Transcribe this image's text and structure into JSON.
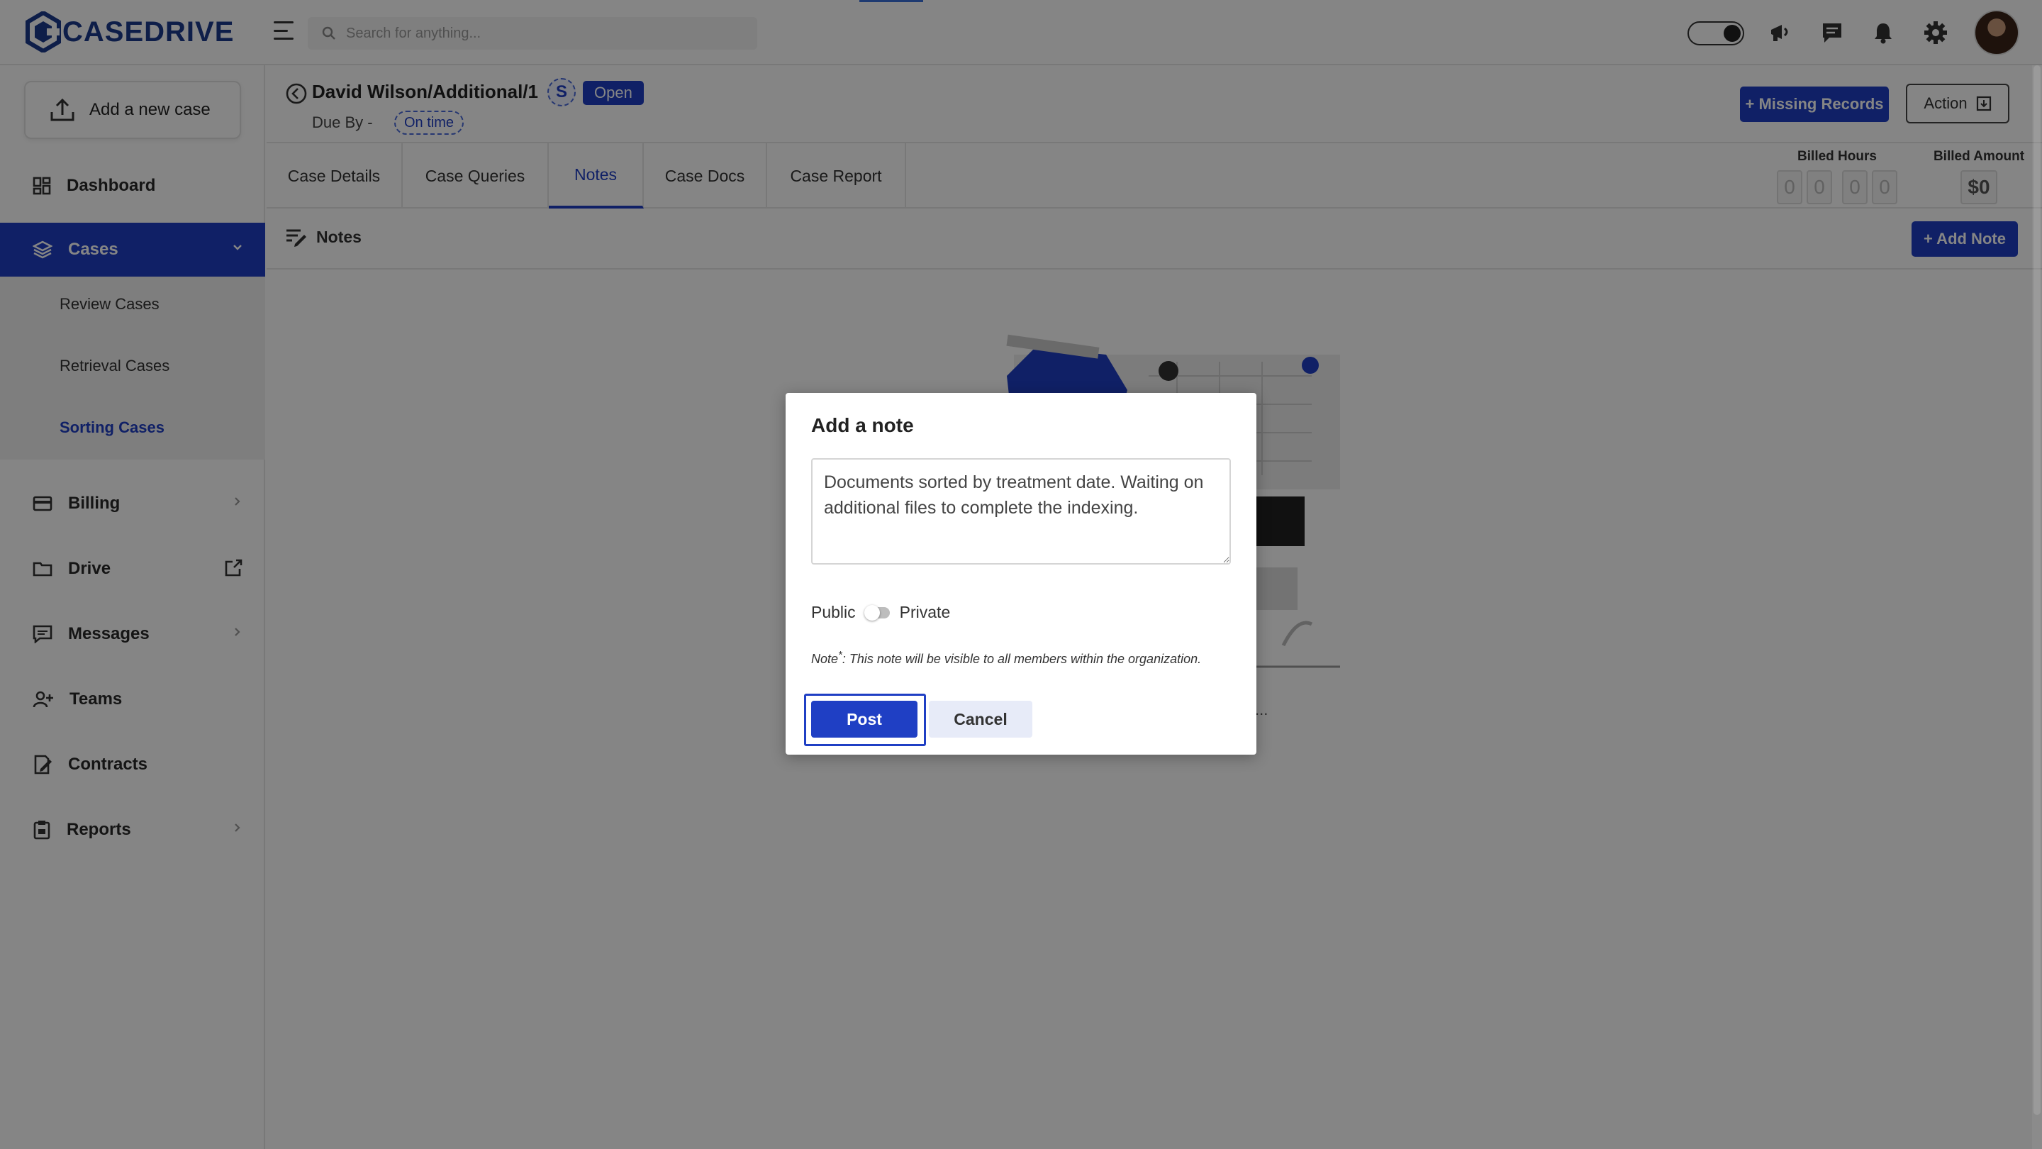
{
  "app": {
    "brand": "CASEDRIVE"
  },
  "search": {
    "placeholder": "Search for anything..."
  },
  "sidebar": {
    "add_case_label": "Add a new case",
    "items": [
      {
        "label": "Dashboard"
      },
      {
        "label": "Cases"
      },
      {
        "label": "Billing"
      },
      {
        "label": "Drive"
      },
      {
        "label": "Messages"
      },
      {
        "label": "Teams"
      },
      {
        "label": "Contracts"
      },
      {
        "label": "Reports"
      }
    ],
    "cases_sub": [
      {
        "label": "Review Cases"
      },
      {
        "label": "Retrieval Cases"
      },
      {
        "label": "Sorting Cases"
      }
    ]
  },
  "case": {
    "title": "David Wilson/Additional/1",
    "s_badge": "S",
    "status": "Open",
    "due_by": "Due By -",
    "timing": "On time"
  },
  "header_actions": {
    "missing_records": "+ Missing Records",
    "action": "Action"
  },
  "tabs": [
    {
      "label": "Case Details"
    },
    {
      "label": "Case Queries"
    },
    {
      "label": "Notes"
    },
    {
      "label": "Case Docs"
    },
    {
      "label": "Case Report"
    }
  ],
  "billing": {
    "hours_label": "Billed Hours",
    "hours_digits": [
      "0",
      "0",
      "0",
      "0"
    ],
    "amount_label": "Billed Amount",
    "amount_value": "$0"
  },
  "notes_section": {
    "title": "Notes",
    "add_note": "+ Add Note",
    "ellipsis": "..."
  },
  "modal": {
    "title": "Add a note",
    "note_text": "Documents sorted by treatment date. Waiting on additional files to complete the indexing.",
    "public_label": "Public",
    "private_label": "Private",
    "note_prefix": "Note",
    "note_star": "*",
    "note_message": ": This note will be visible to all members within the organization.",
    "post_label": "Post",
    "cancel_label": "Cancel"
  },
  "colors": {
    "brand_blue": "#1f3fc4",
    "logo_navy": "#1b3a8c"
  }
}
